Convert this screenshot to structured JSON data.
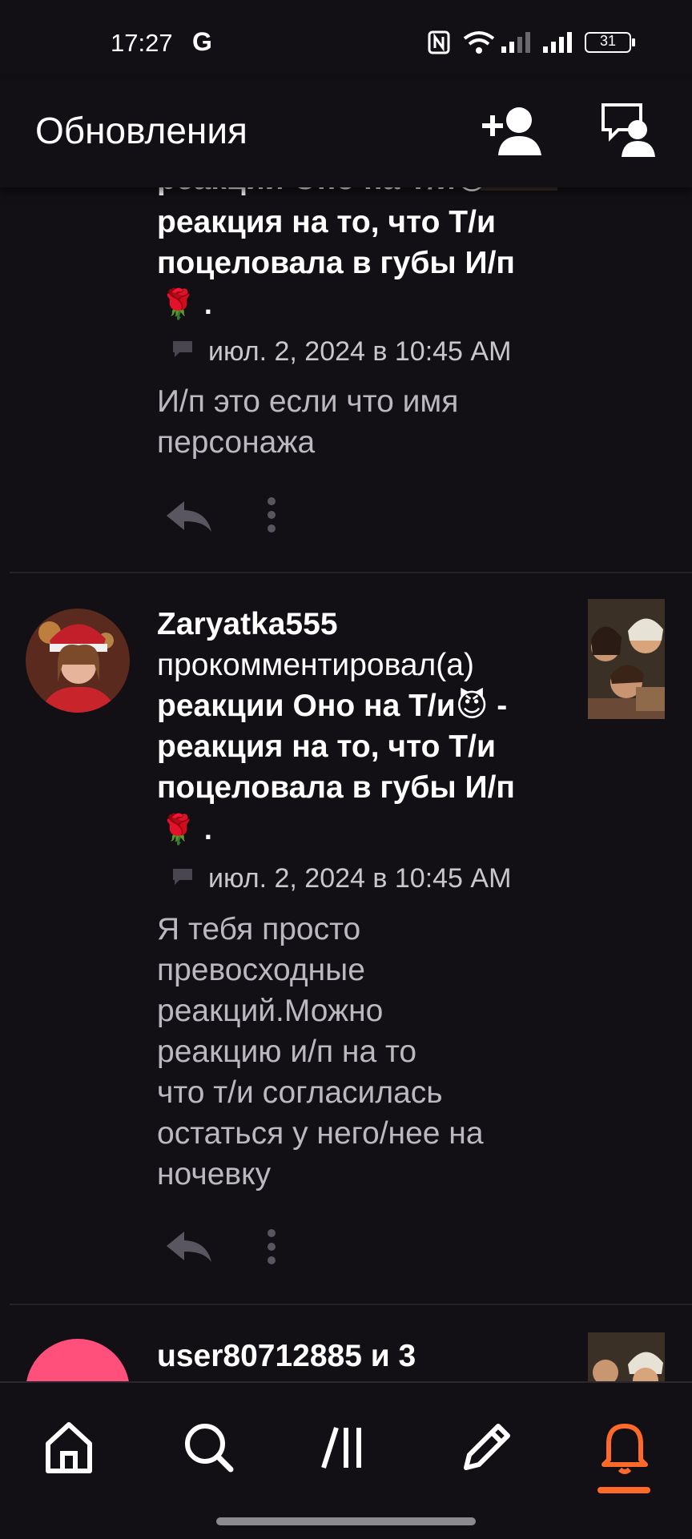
{
  "status_bar": {
    "time": "17:27",
    "g_logo": "G",
    "battery": "31"
  },
  "header": {
    "title": "Обновления",
    "icons": [
      "add-user-icon",
      "chat-user-icon"
    ]
  },
  "feed": {
    "partial_item": {
      "heading_lines": [
        "реакции Оно на Т/и😈",
        "реакция на то, что Т/и",
        "поцеловала в губы И/п",
        "🌹 ."
      ],
      "timestamp": "июл. 2, 2024 в 10:45 AM",
      "comment_lines": [
        "И/п это если что имя",
        "персонажа"
      ]
    },
    "item": {
      "username": "Zaryatka555",
      "action": "прокомментировал(а)",
      "heading_lines": [
        "реакции Оно на Т/и😈 -",
        "реакция на то, что Т/и",
        "поцеловала в губы И/п",
        "🌹 ."
      ],
      "timestamp": "июл. 2, 2024 в 10:45 AM",
      "comment_lines": [
        "Я тебя просто",
        "превосходные",
        "реакций.Можно",
        "реакцию и/п на то",
        "что т/и согласилась",
        "остаться у него/нее на",
        "ночевку"
      ]
    },
    "next_item": {
      "heading": "user80712885 и 3"
    }
  },
  "nav": {
    "items": [
      "home-icon",
      "search-icon",
      "library-icon",
      "write-icon",
      "notifications-icon"
    ],
    "active": "notifications-icon",
    "accent": "#ff6a2b"
  },
  "colors": {
    "background": "#121014",
    "text": "#ffffff",
    "muted": "#bcb8bf",
    "avatar_pink": "#ff4f7b"
  }
}
